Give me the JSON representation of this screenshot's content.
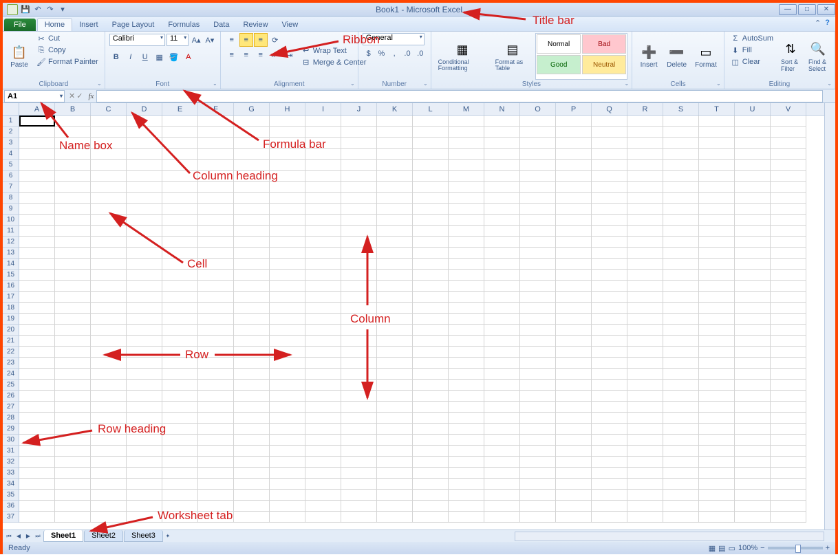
{
  "title": "Book1 - Microsoft Excel",
  "tabs": {
    "file": "File",
    "list": [
      "Home",
      "Insert",
      "Page Layout",
      "Formulas",
      "Data",
      "Review",
      "View"
    ],
    "active": 0
  },
  "clipboard": {
    "paste": "Paste",
    "cut": "Cut",
    "copy": "Copy",
    "fp": "Format Painter",
    "label": "Clipboard"
  },
  "font": {
    "name": "Calibri",
    "size": "11",
    "bold": "B",
    "italic": "I",
    "underline": "U",
    "label": "Font"
  },
  "alignment": {
    "wrap": "Wrap Text",
    "merge": "Merge & Center",
    "label": "Alignment"
  },
  "number": {
    "format": "General",
    "label": "Number"
  },
  "styles": {
    "cond": "Conditional Formatting",
    "table": "Format as Table",
    "normal": "Normal",
    "bad": "Bad",
    "good": "Good",
    "neutral": "Neutral",
    "label": "Styles"
  },
  "cells": {
    "insert": "Insert",
    "delete": "Delete",
    "format": "Format",
    "label": "Cells"
  },
  "editing": {
    "autosum": "AutoSum",
    "fill": "Fill",
    "clear": "Clear",
    "sort": "Sort & Filter",
    "find": "Find & Select",
    "label": "Editing"
  },
  "namebox": "A1",
  "columns": [
    "A",
    "B",
    "C",
    "D",
    "E",
    "F",
    "G",
    "H",
    "I",
    "J",
    "K",
    "L",
    "M",
    "N",
    "O",
    "P",
    "Q",
    "R",
    "S",
    "T",
    "U",
    "V"
  ],
  "rows": 37,
  "sheets": [
    "Sheet1",
    "Sheet2",
    "Sheet3"
  ],
  "status": "Ready",
  "zoom": "100%",
  "annotations": {
    "titlebar": "Title bar",
    "ribbon": "Ribbon",
    "formulabar": "Formula bar",
    "namebox": "Name box",
    "colhead": "Column heading",
    "cell": "Cell",
    "column": "Column",
    "row": "Row",
    "rowhead": "Row heading",
    "wstab": "Worksheet tab"
  }
}
